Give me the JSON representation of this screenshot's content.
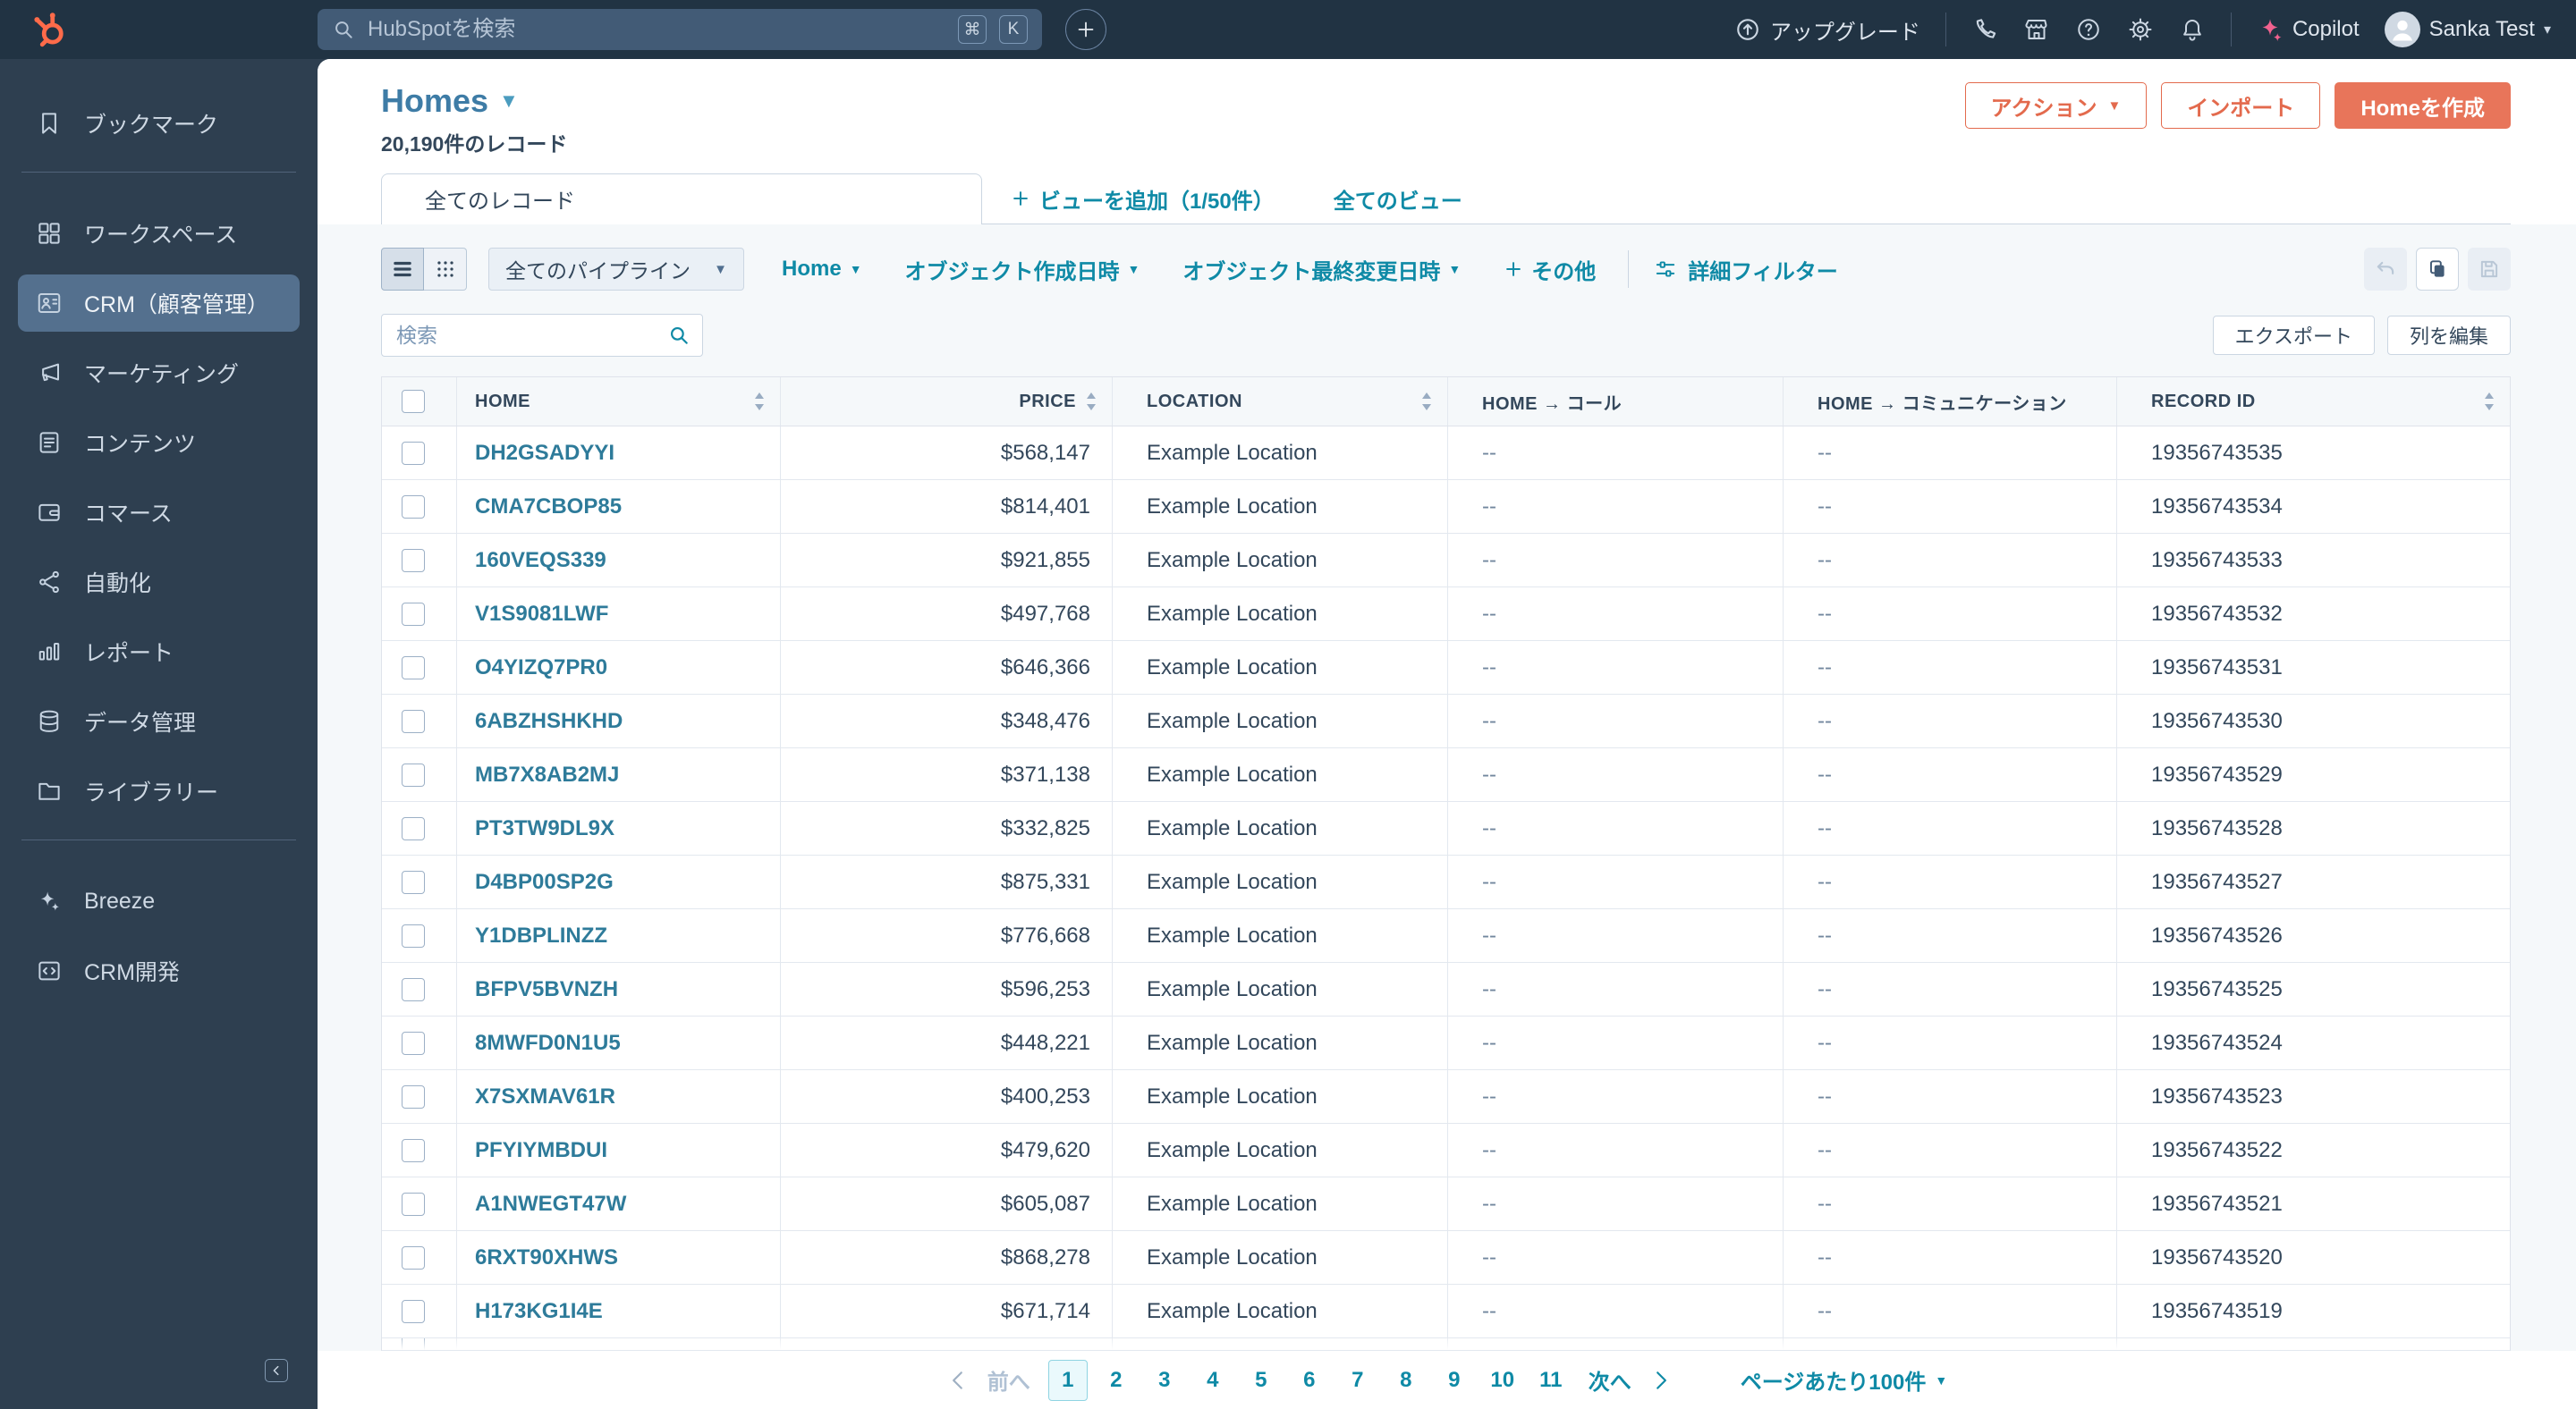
{
  "topbar": {
    "search_placeholder": "HubSpotを検索",
    "shortcut_key_1": "⌘",
    "shortcut_key_2": "K",
    "upgrade_label": "アップグレード",
    "copilot_label": "Copilot",
    "user_name": "Sanka Test"
  },
  "sidebar": {
    "groups": [
      {
        "items": [
          {
            "label": "ブックマーク",
            "icon": "bookmark",
            "active": false
          }
        ]
      },
      {
        "items": [
          {
            "label": "ワークスペース",
            "icon": "workspace",
            "active": false
          },
          {
            "label": "CRM（顧客管理）",
            "icon": "crm",
            "active": true
          },
          {
            "label": "マーケティング",
            "icon": "marketing",
            "active": false
          },
          {
            "label": "コンテンツ",
            "icon": "content",
            "active": false
          },
          {
            "label": "コマース",
            "icon": "commerce",
            "active": false
          },
          {
            "label": "自動化",
            "icon": "automation",
            "active": false
          },
          {
            "label": "レポート",
            "icon": "reporting",
            "active": false
          },
          {
            "label": "データ管理",
            "icon": "database",
            "active": false
          },
          {
            "label": "ライブラリー",
            "icon": "library",
            "active": false
          }
        ]
      },
      {
        "items": [
          {
            "label": "Breeze",
            "icon": "breeze",
            "active": false
          },
          {
            "label": "CRM開発",
            "icon": "code",
            "active": false
          }
        ]
      }
    ]
  },
  "header": {
    "title": "Homes",
    "record_count": "20,190件のレコード",
    "actions_button": "アクション",
    "import_button": "インポート",
    "create_button": "Homeを作成"
  },
  "tabs": {
    "active_tab": "全てのレコード",
    "add_view": "ビューを追加（1/50件）",
    "all_views": "全てのビュー"
  },
  "filters": {
    "pipeline_dropdown": "全てのパイプライン",
    "quick_filters": [
      "Home",
      "オブジェクト作成日時",
      "オブジェクト最終変更日時"
    ],
    "more_filters": "その他",
    "advanced_filters": "詳細フィルター"
  },
  "table_toolbar": {
    "search_placeholder": "検索",
    "export_button": "エクスポート",
    "edit_columns_button": "列を編集"
  },
  "table": {
    "columns": [
      "HOME",
      "PRICE",
      "LOCATION",
      "HOME → コール",
      "HOME → コミュニケーション",
      "RECORD ID"
    ],
    "sortable_columns": [
      "HOME",
      "PRICE",
      "LOCATION",
      "RECORD ID"
    ],
    "rows": [
      {
        "home": "DH2GSADYYI",
        "price": "$568,147",
        "location": "Example Location",
        "calls": "--",
        "communication": "--",
        "record_id": "19356743535"
      },
      {
        "home": "CMA7CBOP85",
        "price": "$814,401",
        "location": "Example Location",
        "calls": "--",
        "communication": "--",
        "record_id": "19356743534"
      },
      {
        "home": "160VEQS339",
        "price": "$921,855",
        "location": "Example Location",
        "calls": "--",
        "communication": "--",
        "record_id": "19356743533"
      },
      {
        "home": "V1S9081LWF",
        "price": "$497,768",
        "location": "Example Location",
        "calls": "--",
        "communication": "--",
        "record_id": "19356743532"
      },
      {
        "home": "O4YIZQ7PR0",
        "price": "$646,366",
        "location": "Example Location",
        "calls": "--",
        "communication": "--",
        "record_id": "19356743531"
      },
      {
        "home": "6ABZHSHKHD",
        "price": "$348,476",
        "location": "Example Location",
        "calls": "--",
        "communication": "--",
        "record_id": "19356743530"
      },
      {
        "home": "MB7X8AB2MJ",
        "price": "$371,138",
        "location": "Example Location",
        "calls": "--",
        "communication": "--",
        "record_id": "19356743529"
      },
      {
        "home": "PT3TW9DL9X",
        "price": "$332,825",
        "location": "Example Location",
        "calls": "--",
        "communication": "--",
        "record_id": "19356743528"
      },
      {
        "home": "D4BP00SP2G",
        "price": "$875,331",
        "location": "Example Location",
        "calls": "--",
        "communication": "--",
        "record_id": "19356743527"
      },
      {
        "home": "Y1DBPLINZZ",
        "price": "$776,668",
        "location": "Example Location",
        "calls": "--",
        "communication": "--",
        "record_id": "19356743526"
      },
      {
        "home": "BFPV5BVNZH",
        "price": "$596,253",
        "location": "Example Location",
        "calls": "--",
        "communication": "--",
        "record_id": "19356743525"
      },
      {
        "home": "8MWFD0N1U5",
        "price": "$448,221",
        "location": "Example Location",
        "calls": "--",
        "communication": "--",
        "record_id": "19356743524"
      },
      {
        "home": "X7SXMAV61R",
        "price": "$400,253",
        "location": "Example Location",
        "calls": "--",
        "communication": "--",
        "record_id": "19356743523"
      },
      {
        "home": "PFYIYMBDUI",
        "price": "$479,620",
        "location": "Example Location",
        "calls": "--",
        "communication": "--",
        "record_id": "19356743522"
      },
      {
        "home": "A1NWEGT47W",
        "price": "$605,087",
        "location": "Example Location",
        "calls": "--",
        "communication": "--",
        "record_id": "19356743521"
      },
      {
        "home": "6RXT90XHWS",
        "price": "$868,278",
        "location": "Example Location",
        "calls": "--",
        "communication": "--",
        "record_id": "19356743520"
      },
      {
        "home": "H173KG1I4E",
        "price": "$671,714",
        "location": "Example Location",
        "calls": "--",
        "communication": "--",
        "record_id": "19356743519"
      }
    ]
  },
  "pagination": {
    "prev_label": "前へ",
    "next_label": "次へ",
    "pages": [
      "1",
      "2",
      "3",
      "4",
      "5",
      "6",
      "7",
      "8",
      "9",
      "10",
      "11"
    ],
    "active_page": "1",
    "page_size_label": "ページあたり100件"
  },
  "colors": {
    "topbar_bg": "#213343",
    "sidebar_bg": "#2e3f50",
    "accent_coral": "#e8755a",
    "link_teal": "#0f8aa6",
    "record_link_teal": "#2e7b9a",
    "text_navy": "#33475b",
    "title_blue": "#3e7ca6",
    "copilot_pink": "#f2628f"
  }
}
